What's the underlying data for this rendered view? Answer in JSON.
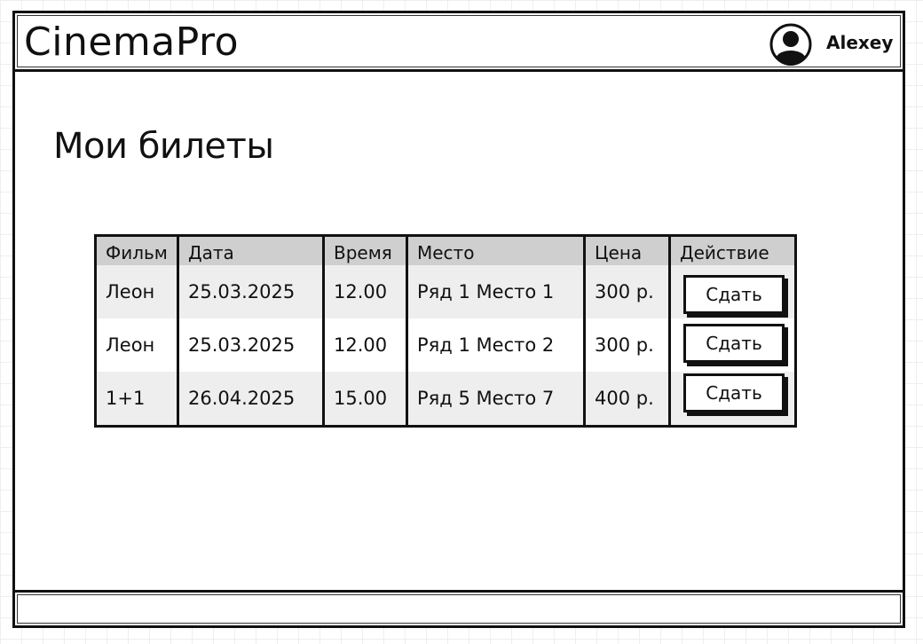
{
  "app": {
    "brand": "CinemaPro",
    "user": {
      "name": "Alexey",
      "avatar_icon": "user-avatar-icon"
    }
  },
  "main": {
    "title": "Мои билеты",
    "table": {
      "columns": [
        "Фильм",
        "Дата",
        "Время",
        "Место",
        "Цена",
        "Действие"
      ],
      "rows": [
        {
          "film": "Леон",
          "date": "25.03.2025",
          "time": "12.00",
          "seat": "Ряд 1 Место 1",
          "price": "300 р.",
          "action": "Сдать"
        },
        {
          "film": "Леон",
          "date": "25.03.2025",
          "time": "12.00",
          "seat": "Ряд 1 Место 2",
          "price": "300 р.",
          "action": "Сдать"
        },
        {
          "film": "1+1",
          "date": "26.04.2025",
          "time": "15.00",
          "seat": "Ряд 5 Место 7",
          "price": "400 р.",
          "action": "Сдать"
        }
      ]
    }
  },
  "colors": {
    "header_bg": "#cfcfcf",
    "row_shade": "#eeeeee",
    "ink": "#111111"
  }
}
